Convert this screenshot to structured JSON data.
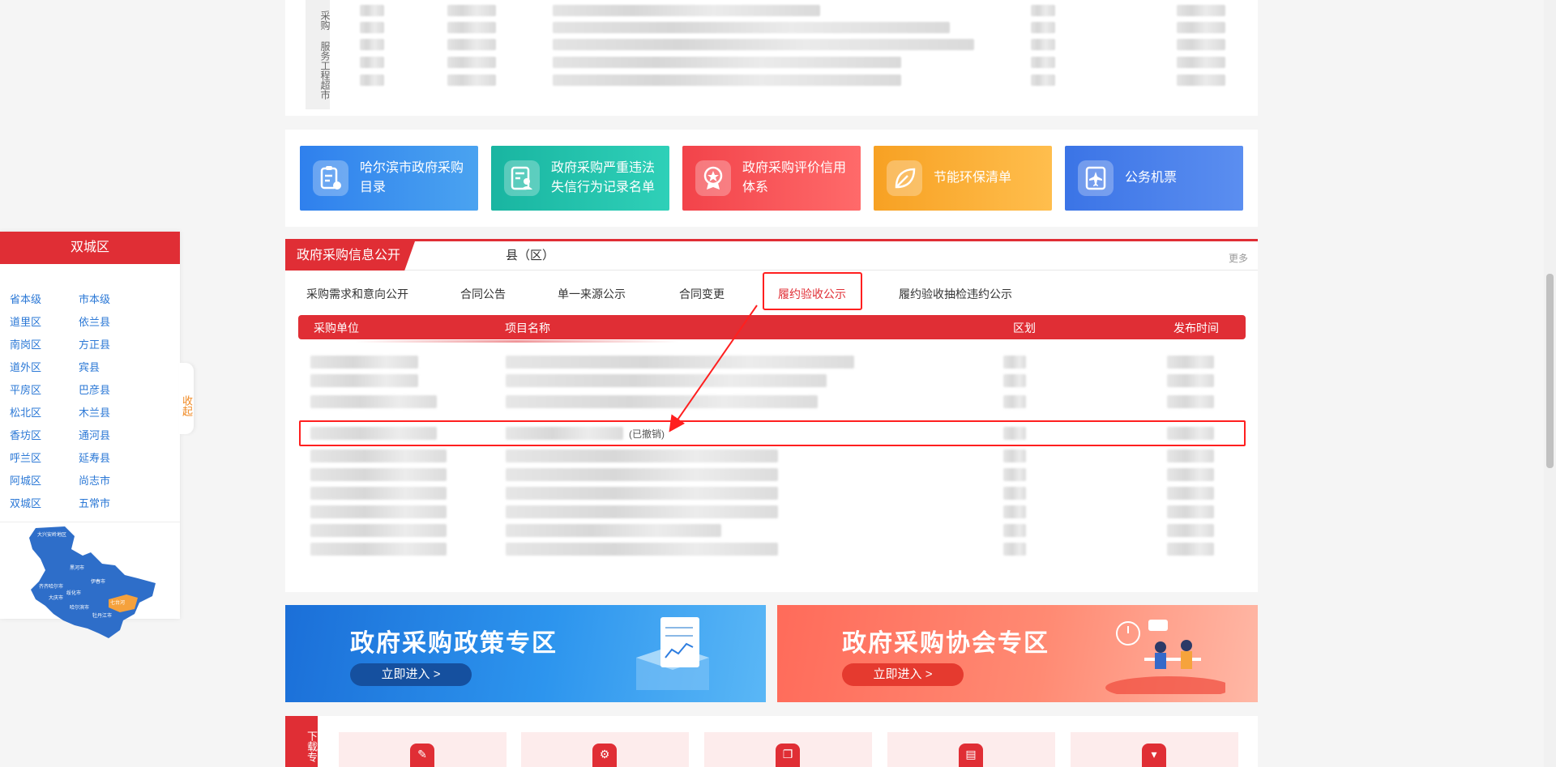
{
  "top_section": {
    "vertical_label": "采购 服务工程超市"
  },
  "tiles": [
    {
      "label": "哈尔滨市政府采购目录",
      "icon": "clipboard-cart-icon",
      "color_from": "#2f80ed",
      "color_to": "#4aa3f0"
    },
    {
      "label": "政府采购严重违法失信行为记录名单",
      "icon": "document-person-icon",
      "color_from": "#19b5a1",
      "color_to": "#2fd0b8"
    },
    {
      "label": "政府采购评价信用体系",
      "icon": "medal-icon",
      "color_from": "#f2434a",
      "color_to": "#ff6a6a"
    },
    {
      "label": "节能环保清单",
      "icon": "leaf-icon",
      "color_from": "#f7a123",
      "color_to": "#ffbe4d"
    },
    {
      "label": "公务机票",
      "icon": "airplane-ticket-icon",
      "color_from": "#3b74e6",
      "color_to": "#5b8ef0"
    }
  ],
  "info": {
    "title": "政府采购信息公开",
    "county_tab": "县（区）",
    "more": "更多",
    "subtabs": [
      "采购需求和意向公开",
      "合同公告",
      "单一来源公示",
      "合同变更",
      "履约验收公示",
      "履约验收抽检违约公示"
    ],
    "active_subtab_index": 4,
    "columns": [
      "采购单位",
      "项目名称",
      "区划",
      "发布时间"
    ],
    "withdrawn_label": "(已撤销)",
    "accent_color": "#e02e35"
  },
  "banners": {
    "policy": {
      "title": "政府采购政策专区",
      "button": "立即进入  >"
    },
    "association": {
      "title": "政府采购协会专区",
      "button": "立即进入  >"
    }
  },
  "download": {
    "label": "下载专",
    "icons": [
      "document-edit-icon",
      "document-gear-icon",
      "copy-icon",
      "book-icon",
      "download-box-icon"
    ]
  },
  "region_panel": {
    "title": "双城区",
    "left_column": [
      "省本级",
      "道里区",
      "南岗区",
      "道外区",
      "平房区",
      "松北区",
      "香坊区",
      "呼兰区",
      "阿城区",
      "双城区"
    ],
    "right_column": [
      "市本级",
      "依兰县",
      "方正县",
      "宾县",
      "巴彦县",
      "木兰县",
      "通河县",
      "延寿县",
      "尚志市",
      "五常市"
    ],
    "collapse": "收起",
    "map_labels": [
      "大兴安岭地区",
      "黑河市",
      "伊春市",
      "齐齐哈尔市",
      "绥化市",
      "大庆市",
      "哈尔滨市",
      "七台河",
      "牡丹江市"
    ]
  }
}
